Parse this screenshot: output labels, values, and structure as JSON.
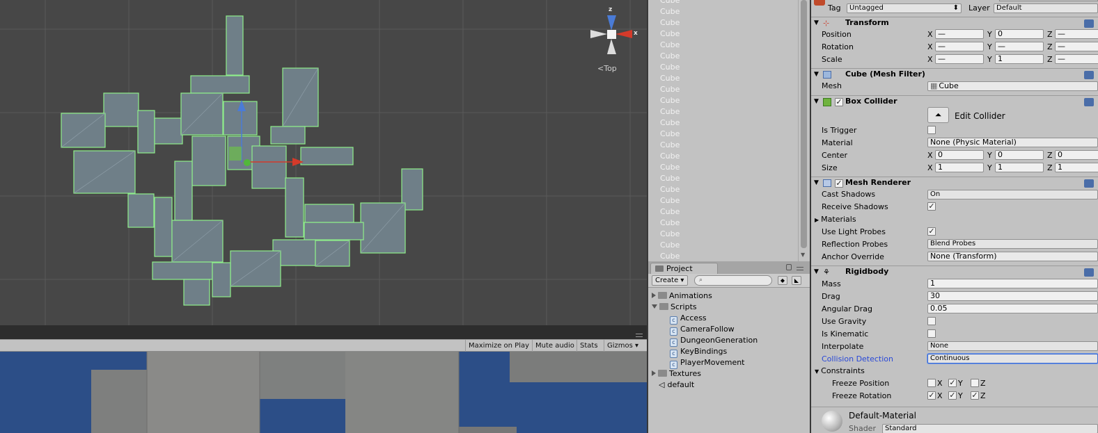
{
  "scene_view": {
    "gizmo": {
      "view_label": "Top",
      "x_axis": "x",
      "y_axis": "z"
    }
  },
  "game_view": {
    "toolbar": {
      "maximize": "Maximize on Play",
      "mute": "Mute audio",
      "stats": "Stats",
      "gizmos": "Gizmos"
    }
  },
  "hierarchy": {
    "items": [
      "Cube",
      "Cube",
      "Cube",
      "Cube",
      "Cube",
      "Cube",
      "Cube",
      "Cube",
      "Cube",
      "Cube",
      "Cube",
      "Cube",
      "Cube",
      "Cube",
      "Cube",
      "Cube",
      "Cube",
      "Cube",
      "Cube",
      "Cube",
      "Cube",
      "Cube",
      "Cube",
      "Cube"
    ]
  },
  "project": {
    "tab_label": "Project",
    "create_label": "Create",
    "tree": [
      {
        "label": "Animations",
        "type": "folder",
        "expanded": false
      },
      {
        "label": "Scripts",
        "type": "folder",
        "expanded": true
      },
      {
        "label": "Access",
        "type": "script"
      },
      {
        "label": "CameraFollow",
        "type": "script"
      },
      {
        "label": "DungeonGeneration",
        "type": "script"
      },
      {
        "label": "KeyBindings",
        "type": "script"
      },
      {
        "label": "PlayerMovement",
        "type": "script"
      },
      {
        "label": "Textures",
        "type": "folder",
        "expanded": false
      },
      {
        "label": "default",
        "type": "scene"
      }
    ]
  },
  "inspector": {
    "tag_label": "Tag",
    "tag_value": "Untagged",
    "layer_label": "Layer",
    "layer_value": "Default",
    "transform": {
      "title": "Transform",
      "position_label": "Position",
      "rotation_label": "Rotation",
      "scale_label": "Scale",
      "axis_x": "X",
      "axis_y": "Y",
      "axis_z": "Z",
      "position": [
        "—",
        "0",
        "—"
      ],
      "rotation": [
        "—",
        "—",
        "—"
      ],
      "scale": [
        "—",
        "1",
        "—"
      ]
    },
    "mesh_filter": {
      "title": "Cube (Mesh Filter)",
      "mesh_label": "Mesh",
      "mesh_value": "Cube"
    },
    "box_collider": {
      "title": "Box Collider",
      "edit_label": "Edit Collider",
      "is_trigger_label": "Is Trigger",
      "material_label": "Material",
      "material_value": "None (Physic Material)",
      "center_label": "Center",
      "center": [
        "0",
        "0",
        "0"
      ],
      "size_label": "Size",
      "size": [
        "1",
        "1",
        "1"
      ]
    },
    "mesh_renderer": {
      "title": "Mesh Renderer",
      "cast_shadows_label": "Cast Shadows",
      "cast_shadows_value": "On",
      "receive_shadows_label": "Receive Shadows",
      "materials_label": "Materials",
      "light_probes_label": "Use Light Probes",
      "reflection_probes_label": "Reflection Probes",
      "reflection_probes_value": "Blend Probes",
      "anchor_override_label": "Anchor Override",
      "anchor_override_value": "None (Transform)"
    },
    "rigidbody": {
      "title": "Rigidbody",
      "mass_label": "Mass",
      "mass_value": "1",
      "drag_label": "Drag",
      "drag_value": "30",
      "angular_drag_label": "Angular Drag",
      "angular_drag_value": "0.05",
      "use_gravity_label": "Use Gravity",
      "is_kinematic_label": "Is Kinematic",
      "interpolate_label": "Interpolate",
      "interpolate_value": "None",
      "collision_label": "Collision Detection",
      "collision_value": "Continuous",
      "constraints_label": "Constraints",
      "freeze_position_label": "Freeze Position",
      "freeze_rotation_label": "Freeze Rotation",
      "axis_x": "X",
      "axis_y": "Y",
      "axis_z": "Z"
    },
    "material": {
      "title": "Default-Material",
      "shader_label": "Shader",
      "shader_value": "Standard"
    }
  },
  "colors": {
    "scene_bg": "#474747",
    "game_sky": "#2c4e87",
    "panel_bg": "#c2c2c2",
    "selection_outline": "#8ff08a",
    "link_blue": "#2a49d8"
  }
}
